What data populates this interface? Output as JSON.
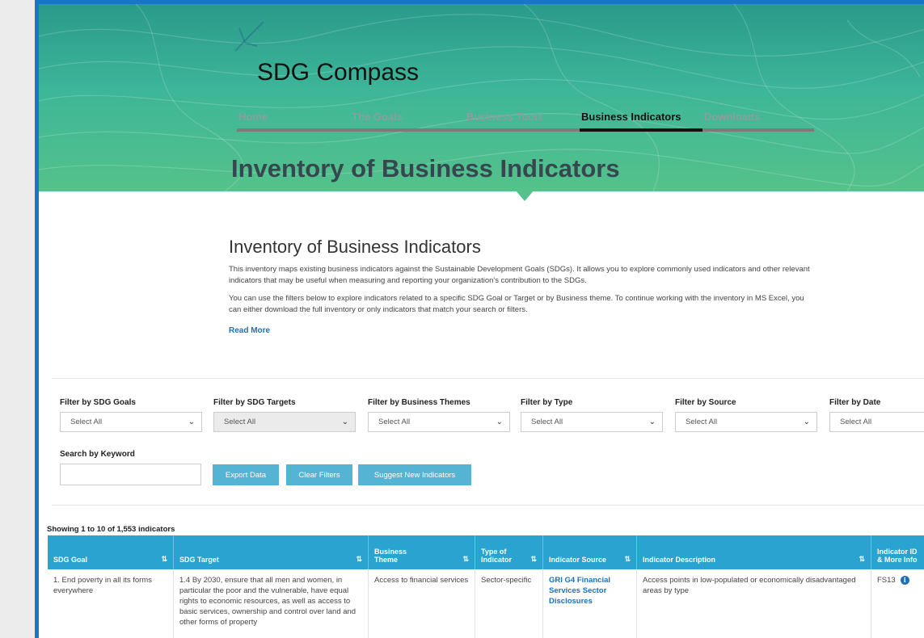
{
  "site": {
    "title": "SDG Compass"
  },
  "nav": {
    "items": [
      "Home",
      "The Goals",
      "Business Tools",
      "Business Indicators",
      "Downloads"
    ],
    "active": "Business Indicators"
  },
  "hero": {
    "heading": "Inventory of Business Indicators"
  },
  "intro": {
    "heading": "Inventory of Business Indicators",
    "paragraph1": "This inventory maps existing business indicators against the Sustainable Development Goals (SDGs). It allows you to explore commonly used indicators and other relevant indicators that may be useful when measuring and reporting your organization's contribution to the SDGs.",
    "paragraph2": "You can use the filters below to explore indicators related to a specific SDG Goal or Target or by Business theme. To continue working with the inventory in MS Excel, you can either download the full inventory or only indicators that match your search or filters.",
    "read_more": "Read More"
  },
  "filters": [
    {
      "label": "Filter by SDG Goals",
      "value": "Select All"
    },
    {
      "label": "Filter by SDG Targets",
      "value": "Select All"
    },
    {
      "label": "Filter by Business Themes",
      "value": "Select All"
    },
    {
      "label": "Filter by Type",
      "value": "Select All"
    },
    {
      "label": "Filter by Source",
      "value": "Select All"
    },
    {
      "label": "Filter by Date",
      "value": "Select All"
    }
  ],
  "search": {
    "label": "Search by Keyword",
    "value": ""
  },
  "buttons": {
    "export": "Export Data",
    "clear": "Clear Filters",
    "suggest": "Suggest New Indicators"
  },
  "table": {
    "showing": "Showing 1 to 10 of 1,553 indicators",
    "columns": [
      "SDG Goal",
      "SDG Target",
      "Business Theme",
      "Type of Indicator",
      "Indicator Source",
      "Indicator Description",
      "Indicator ID & More Info"
    ],
    "columns_display": [
      "SDG Goal",
      "SDG Target",
      "Business\nTheme",
      "Type of\nIndicator",
      "Indicator Source",
      "Indicator Description",
      "Indicator ID\n& More Info"
    ],
    "rows": [
      {
        "goal": "1. End poverty in all its forms everywhere",
        "target": "1.4 By 2030, ensure that all men and women, in particular the poor and the vulnerable, have equal rights to economic resources, as well as access to basic services, ownership and control over land and other forms of property",
        "theme": "Access to financial services",
        "type": "Sector-specific",
        "source": "GRI G4 Financial Services Sector Disclosures",
        "description": "Access points in low-populated or economically disadvantaged areas by type",
        "id": "FS13"
      }
    ]
  },
  "colors": {
    "hero_top": "#2a9a8a",
    "hero_bottom": "#55c28a",
    "accent_button": "#55b3d4",
    "table_header": "#2aa3d0",
    "link": "#1b70b8",
    "frame": "#1976c6"
  }
}
